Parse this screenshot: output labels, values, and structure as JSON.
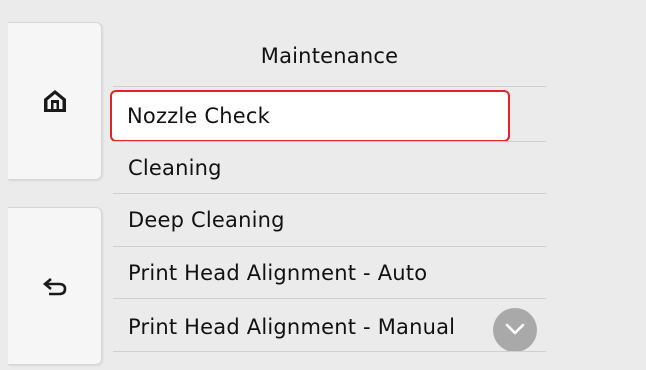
{
  "screen": {
    "title": "Maintenance",
    "menu": [
      {
        "label": "Nozzle Check",
        "selected": true
      },
      {
        "label": "Cleaning",
        "selected": false
      },
      {
        "label": "Deep Cleaning",
        "selected": false
      },
      {
        "label": "Print Head Alignment - Auto",
        "selected": false
      },
      {
        "label": "Print Head Alignment - Manual",
        "selected": false
      }
    ]
  },
  "icons": {
    "home": "home-icon",
    "back": "back-arrow-icon",
    "scroll": "chevron-down-icon"
  },
  "colors": {
    "selection_border": "#e0252a",
    "background": "#ebebeb",
    "button": "#f6f6f6",
    "scroll_button": "#a9a9a9"
  }
}
